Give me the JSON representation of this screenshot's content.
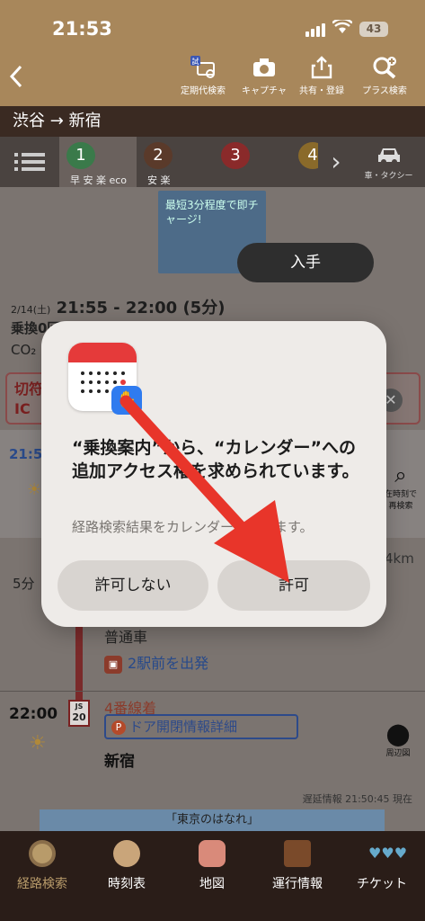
{
  "status": {
    "time": "21:53",
    "battery": "43"
  },
  "toolbar": {
    "tools": [
      {
        "label": "定期代検索",
        "badge": "試"
      },
      {
        "label": "キャプチャ"
      },
      {
        "label": "共有・登録"
      },
      {
        "label": "プラス検索"
      }
    ]
  },
  "route": {
    "title": "渋谷 → 新宿"
  },
  "tabs": {
    "r1": {
      "num": "1",
      "label": "早 安 楽 eco"
    },
    "r2": {
      "num": "2",
      "label": "安 楽"
    },
    "r3": {
      "num": "3"
    },
    "r4": {
      "num": "4"
    },
    "taxi": "車・タクシー"
  },
  "content": {
    "ad_top": "最短3分程度で即チャージ!",
    "acquire": "入手",
    "date": "2/14(土)",
    "time_range": "21:55 - 22:00 (5分)",
    "transfer": "乗換0回",
    "co2": "CO₂",
    "notice_line1": "切符",
    "notice_line2": "IC",
    "time1": "21:5",
    "research_label": "在時刻で再検索",
    "duration": "5分",
    "distance": "4km",
    "train_type": "普通車",
    "depart_hint": "2駅前を出発",
    "arr_time": "22:00",
    "platform": "4番線着",
    "badge_line": "JS",
    "badge_num": "20",
    "door_info": "ドア開閉情報詳細",
    "station": "新宿",
    "surround": "周辺図",
    "delay_info": "遅延情報 21:50:45 現在",
    "ad_bottom": "「東京のはなれ」"
  },
  "modal": {
    "title": "“乗換案内”から、“カレンダー”への追加アクセス権を求められています。",
    "subtitle": "経路検索結果をカレンダーに送ります。",
    "deny": "許可しない",
    "allow": "許可"
  },
  "bottomnav": [
    {
      "label": "経路検索",
      "active": true
    },
    {
      "label": "時刻表"
    },
    {
      "label": "地図"
    },
    {
      "label": "運行情報"
    },
    {
      "label": "チケット"
    }
  ],
  "colors": {
    "brand": "#a8875b",
    "dark": "#2a1d18",
    "annotation": "#e8352a"
  }
}
